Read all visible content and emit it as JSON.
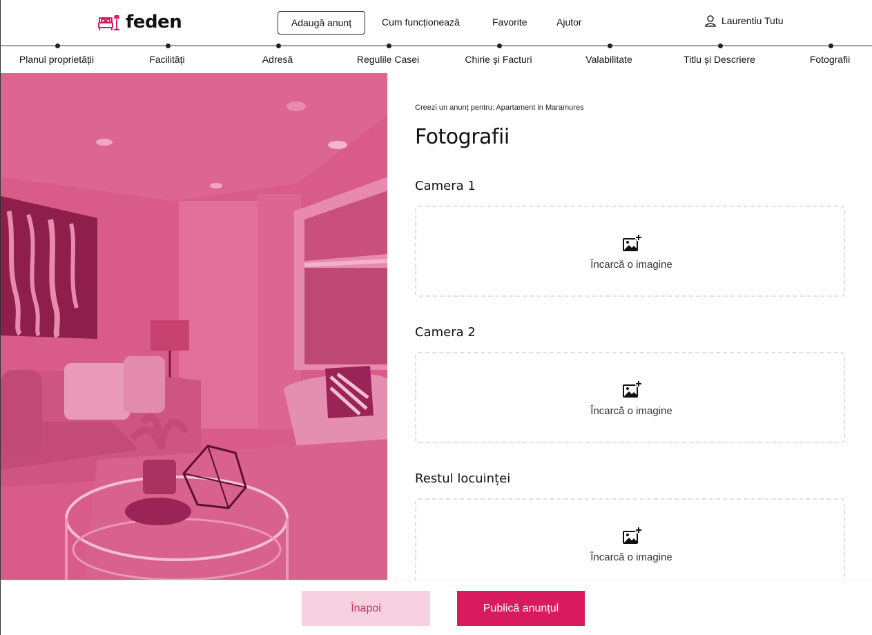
{
  "brand": {
    "name": "feden",
    "accent": "#d81b5e",
    "icon": "bed-lamp-logo-icon"
  },
  "nav": {
    "add_listing": "Adaugă anunț",
    "links": [
      "Cum funcționează",
      "Favorite",
      "Ajutor"
    ],
    "user_name": "Laurentiu Tutu",
    "user_icon": "user-icon"
  },
  "steps": [
    "Planul proprietății",
    "Facilități",
    "Adresă",
    "Regulile Casei",
    "Chirie și Facturi",
    "Valabilitate",
    "Titlu și Descriere",
    "Fotografii"
  ],
  "form": {
    "subtitle": "Creezi un anunț pentru: Apartament in Maramures",
    "title": "Fotografii",
    "sections": [
      {
        "title": "Camera 1",
        "upload_label": "Încarcă o imagine"
      },
      {
        "title": "Camera 2",
        "upload_label": "Încarcă o imagine"
      },
      {
        "title": "Restul locuinței",
        "upload_label": "Încarcă o imagine"
      }
    ]
  },
  "footer": {
    "back_label": "Înapoi",
    "publish_label": "Publică anunțul",
    "back_bg": "#f7d1df",
    "publish_bg": "#d81b5e"
  }
}
